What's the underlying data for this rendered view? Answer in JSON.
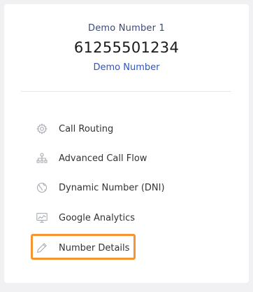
{
  "number": {
    "name": "Demo Number 1",
    "value": "61255501234",
    "subtitle": "Demo Number"
  },
  "menu": {
    "items": [
      {
        "label": "Call Routing",
        "icon": "gear-icon"
      },
      {
        "label": "Advanced Call Flow",
        "icon": "flow-tree-icon"
      },
      {
        "label": "Dynamic Number (DNI)",
        "icon": "globe-icon"
      },
      {
        "label": "Google Analytics",
        "icon": "analytics-monitor-icon"
      },
      {
        "label": "Number Details",
        "icon": "pencil-icon"
      }
    ],
    "highlighted_index": 4
  },
  "colors": {
    "title": "#3a4a7a",
    "subtitle_link": "#2d55c8",
    "highlight_border": "#f39530",
    "icon": "#a8aab2"
  }
}
